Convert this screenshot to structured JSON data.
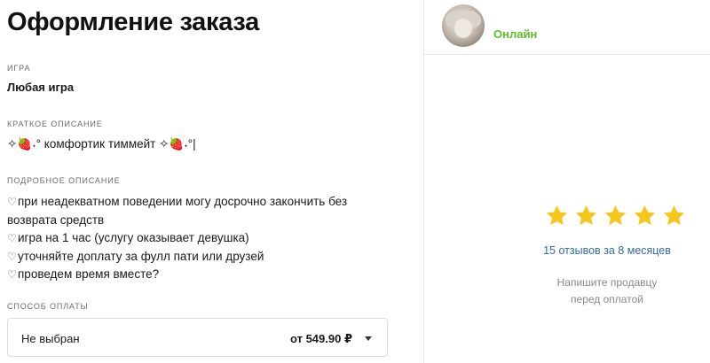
{
  "page": {
    "title": "Оформление заказа"
  },
  "game": {
    "label": "ИГРА",
    "value": "Любая игра"
  },
  "short_description": {
    "label": "КРАТКОЕ ОПИСАНИЕ",
    "value": "✧🍓˖° комфортик тиммейт ✧🍓˖°|"
  },
  "detailed_description": {
    "label": "ПОДРОБНОЕ ОПИСАНИЕ",
    "lines": [
      "при неадекватном поведении могу досрочно закончить без",
      "возврата средств",
      "игра на 1 час (услугу оказывает девушка)",
      "уточняйте доплату за фулл пати или друзей",
      "проведем время вместе?"
    ],
    "heart_glyph": "♡"
  },
  "payment": {
    "label": "СПОСОБ ОПЛАТЫ",
    "selected": "Не выбран",
    "price": "от 549.90 ₽"
  },
  "seller": {
    "status": "Онлайн",
    "status_color": "#5cbf2a",
    "rating_stars": 5,
    "star_color": "#f7c61c",
    "reviews": "15 отзывов за 8 месяцев",
    "hint_line1": "Напишите продавцу",
    "hint_line2": "перед оплатой"
  }
}
